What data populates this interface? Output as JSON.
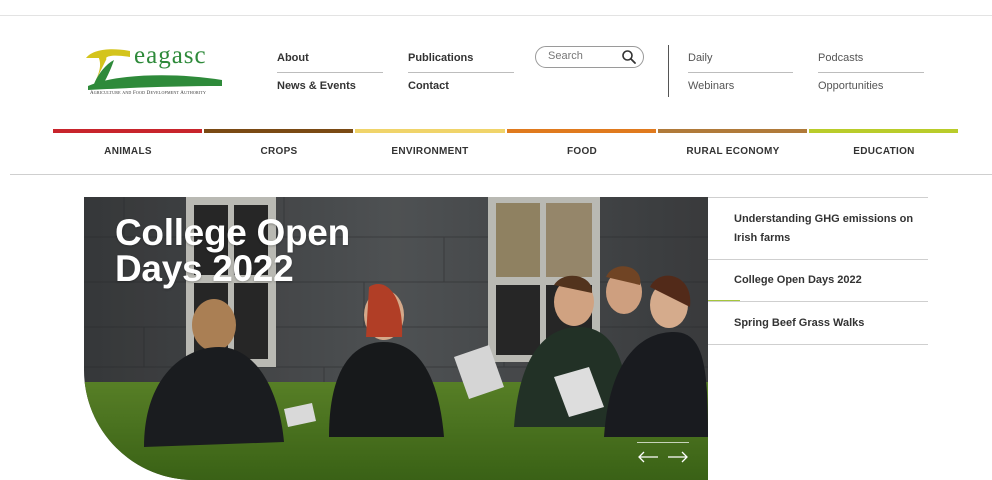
{
  "logo": {
    "word": "eagasc",
    "tagline": "Agriculture and Food Development Authority"
  },
  "utility_nav": {
    "links": [
      "About",
      "Publications",
      "News & Events",
      "Contact"
    ],
    "search_placeholder": "Search",
    "secondary_links": [
      "Daily",
      "Podcasts",
      "Webinars",
      "Opportunities"
    ]
  },
  "categories": [
    {
      "label": "ANIMALS",
      "color": "#c8242c"
    },
    {
      "label": "CROPS",
      "color": "#7a4a14"
    },
    {
      "label": "ENVIRONMENT",
      "color": "#f0d46a"
    },
    {
      "label": "FOOD",
      "color": "#e07a1e"
    },
    {
      "label": "RURAL ECONOMY",
      "color": "#b07a3a"
    },
    {
      "label": "EDUCATION",
      "color": "#b9cc2a"
    }
  ],
  "hero": {
    "title": "College Open Days 2022",
    "prev_arrow": "⟵",
    "next_arrow": "⟶"
  },
  "stories": [
    "Understanding GHG emissions on Irish farms",
    "College Open Days 2022",
    "Spring Beef Grass Walks"
  ],
  "colors": {
    "brand_green": "#2e8a3a",
    "accent_green": "#a5c63c"
  }
}
